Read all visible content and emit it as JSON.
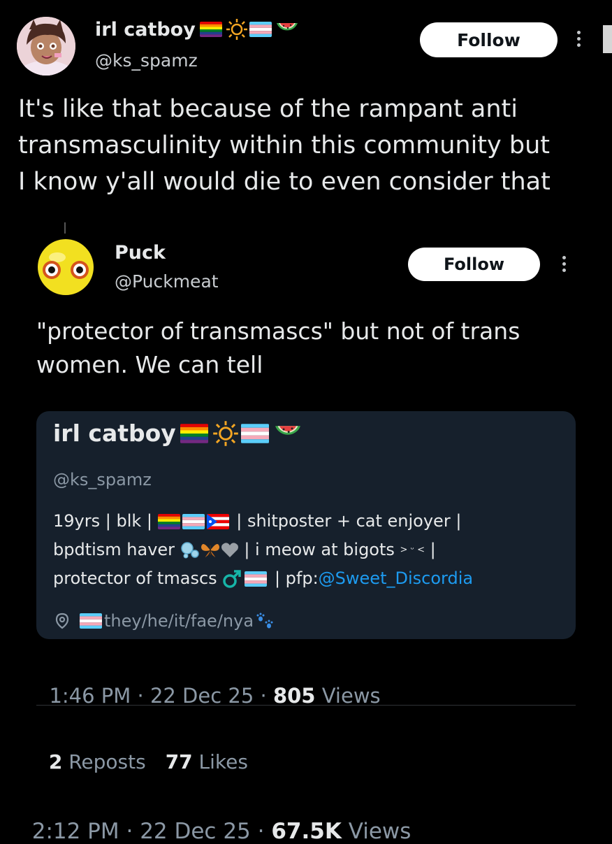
{
  "main_tweet": {
    "author": {
      "name": "irl catboy",
      "handle": "@ks_spamz"
    },
    "follow_label": "Follow",
    "text": "It's like that because of the rampant anti transmasculinity within this community but I know y'all would die to even consider that",
    "text_lines": [
      "It's like that because of the rampant anti",
      "transmasculinity within this community but",
      "I know y'all would die to even consider that"
    ],
    "timestamp": "2:12 PM · 22 Dec 25 · ",
    "views_count": "67.5K",
    "views_label": " Views"
  },
  "quoted_tweet": {
    "author": {
      "name": "Puck",
      "handle": "@Puckmeat"
    },
    "follow_label": "Follow",
    "text_lines": [
      "\"protector of transmascs\" but not of trans",
      "women. We can tell"
    ],
    "bio_card": {
      "name": "irl catboy",
      "handle": "@ks_spamz",
      "bio_line1_a": "19yrs | blk | ",
      "bio_line1_b": " | shitposter + cat enjoyer |",
      "bio_line2_a": "bpdtism haver ",
      "bio_line2_b": " | i meow at bigots ",
      "bio_line2_c": "> ᵕ <",
      "bio_line2_d": " |",
      "bio_line3_a": "protector of tmascs ",
      "bio_line3_b": " | pfp:",
      "bio_mention": "@Sweet_Discordia",
      "location": "they/he/it/fae/nya"
    },
    "timestamp": "1:46 PM · 22 Dec 25 · ",
    "views_count": "805",
    "views_label": " Views",
    "reposts_count": "2",
    "reposts_label": " Reposts",
    "likes_count": "77",
    "likes_label": " Likes"
  },
  "colors": {
    "background": "#000000",
    "card": "#16202c",
    "link": "#1d9bf0",
    "muted": "#8b98a5"
  },
  "icons": [
    "rainbow-flag-icon",
    "sun-icon",
    "trans-flag-icon",
    "watermelon-icon",
    "puerto-rico-flag-icon",
    "bubbles-icon",
    "butterfly-icon",
    "grey-heart-icon",
    "male-sign-icon",
    "paw-prints-icon",
    "location-icon",
    "more-icon"
  ]
}
